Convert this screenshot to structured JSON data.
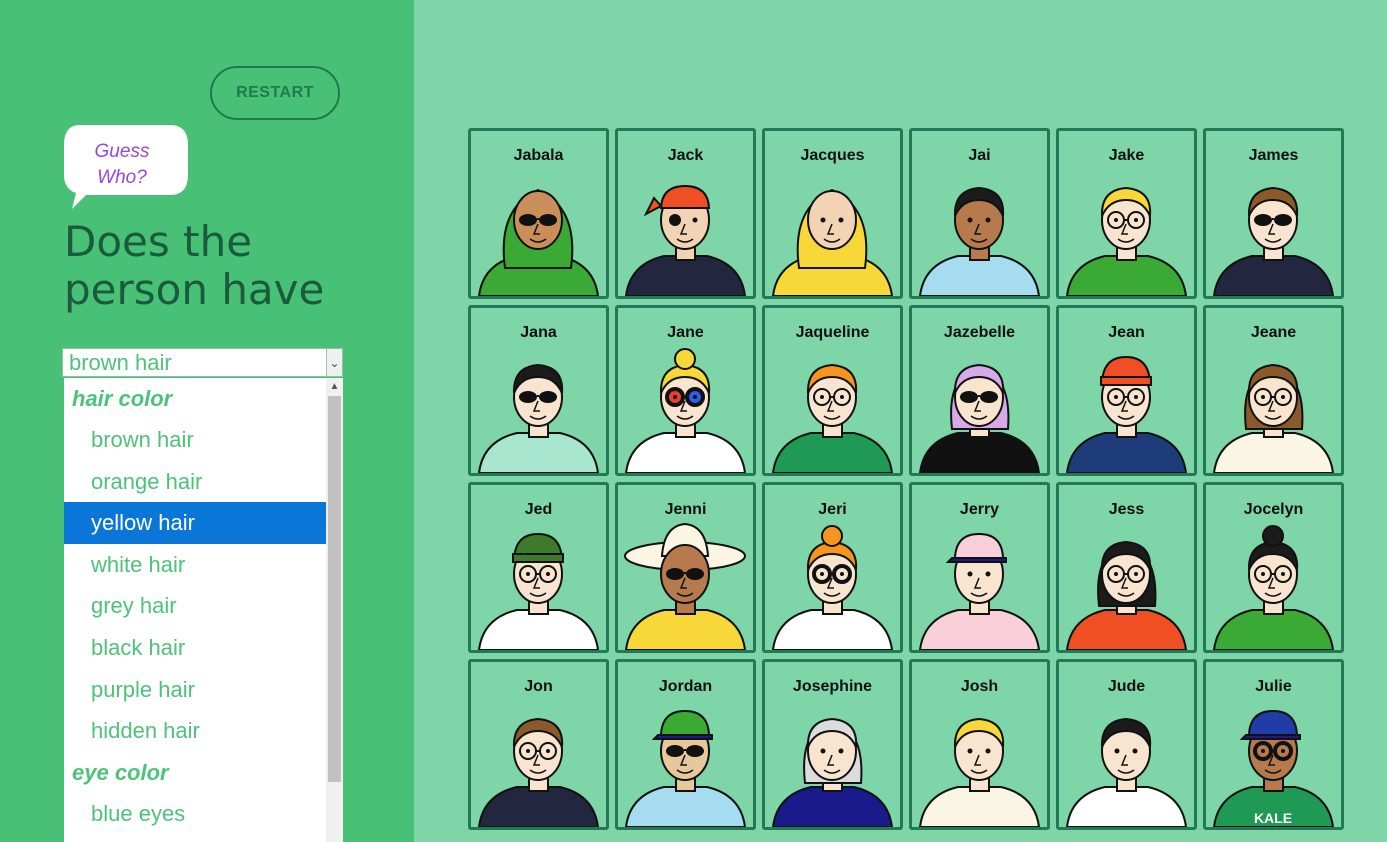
{
  "sidebar": {
    "restart_label": "RESTART",
    "logo_line1": "Guess",
    "logo_line2": "Who?",
    "question": "Does the person have",
    "select": {
      "value": "brown hair",
      "groups": [
        {
          "label": "hair color",
          "options": [
            "brown hair",
            "orange hair",
            "yellow hair",
            "white hair",
            "grey hair",
            "black hair",
            "purple hair",
            "hidden hair"
          ]
        },
        {
          "label": "eye color",
          "options": [
            "blue eyes"
          ]
        }
      ],
      "highlighted": "yellow hair"
    }
  },
  "cards": [
    {
      "name": "Jabala",
      "skin": "#c98e5a",
      "hair": "#3aaa35",
      "shirt": "#3aaa35",
      "hat": "hijab",
      "glasses": "sun"
    },
    {
      "name": "Jack",
      "skin": "#f2d3b3",
      "hair": "#f04e23",
      "shirt": "#22263f",
      "hat": "bandana",
      "glasses": "patch"
    },
    {
      "name": "Jacques",
      "skin": "#f2d3b3",
      "hair": "#f7d838",
      "shirt": "#f7d838",
      "hat": "hood",
      "glasses": "none"
    },
    {
      "name": "Jai",
      "skin": "#b77a4c",
      "hair": "#1b1b1b",
      "shirt": "#a6dcf0",
      "hat": "none",
      "glasses": "none"
    },
    {
      "name": "Jake",
      "skin": "#f8e4cf",
      "hair": "#f7d838",
      "shirt": "#3aaa35",
      "hat": "none",
      "glasses": "regular"
    },
    {
      "name": "James",
      "skin": "#f8e4cf",
      "hair": "#8a5a2b",
      "shirt": "#22263f",
      "hat": "none",
      "glasses": "sun"
    },
    {
      "name": "Jana",
      "skin": "#f8e4cf",
      "hair": "#1b1b1b",
      "shirt": "#a8e6cf",
      "hat": "none",
      "glasses": "sun"
    },
    {
      "name": "Jane",
      "skin": "#f8e4cf",
      "hair": "#f7d838",
      "shirt": "#ffffff",
      "hat": "bun",
      "glasses": "round"
    },
    {
      "name": "Jaqueline",
      "skin": "#f8e4cf",
      "hair": "#f7941d",
      "shirt": "#1f9a55",
      "hat": "none",
      "glasses": "regular"
    },
    {
      "name": "Jazebelle",
      "skin": "#f8e4cf",
      "hair": "#d7a9e8",
      "shirt": "#111111",
      "hat": "none",
      "glasses": "sun"
    },
    {
      "name": "Jean",
      "skin": "#f8e4cf",
      "hair": "#f04e23",
      "shirt": "#1f3c7a",
      "hat": "beanie",
      "glasses": "regular"
    },
    {
      "name": "Jeane",
      "skin": "#f8e4cf",
      "hair": "#8a5a2b",
      "shirt": "#fbf6e3",
      "hat": "none",
      "glasses": "regular"
    },
    {
      "name": "Jed",
      "skin": "#f8e4cf",
      "hair": "#f7941d",
      "shirt": "#ffffff",
      "hat": "beanie-green",
      "glasses": "regular"
    },
    {
      "name": "Jenni",
      "skin": "#b77a4c",
      "hair": "#fbf6e3",
      "shirt": "#f7d838",
      "hat": "sunhat",
      "glasses": "sun"
    },
    {
      "name": "Jeri",
      "skin": "#f8e4cf",
      "hair": "#f7941d",
      "shirt": "#ffffff",
      "hat": "bun",
      "glasses": "round-black"
    },
    {
      "name": "Jerry",
      "skin": "#f8e4cf",
      "hair": "#1b1b1b",
      "shirt": "#f9cfd9",
      "hat": "cap",
      "glasses": "none"
    },
    {
      "name": "Jess",
      "skin": "#f8e4cf",
      "hair": "#1b1b1b",
      "shirt": "#f04e23",
      "hat": "none",
      "glasses": "regular"
    },
    {
      "name": "Jocelyn",
      "skin": "#f8e4cf",
      "hair": "#1b1b1b",
      "shirt": "#3aaa35",
      "hat": "bun",
      "glasses": "regular"
    },
    {
      "name": "Jon",
      "skin": "#f8e4cf",
      "hair": "#8a5a2b",
      "shirt": "#22263f",
      "hat": "none",
      "glasses": "regular"
    },
    {
      "name": "Jordan",
      "skin": "#e6c89a",
      "hair": "#f7d838",
      "shirt": "#a6dcf0",
      "hat": "cap-green",
      "glasses": "sun"
    },
    {
      "name": "Josephine",
      "skin": "#f8e4cf",
      "hair": "#dcdcdc",
      "shirt": "#1a1a8a",
      "hat": "none",
      "glasses": "none"
    },
    {
      "name": "Josh",
      "skin": "#f8e4cf",
      "hair": "#f7d838",
      "shirt": "#fbf6e3",
      "hat": "none",
      "glasses": "none"
    },
    {
      "name": "Jude",
      "skin": "#f8e4cf",
      "hair": "#1b1b1b",
      "shirt": "#ffffff",
      "hat": "none",
      "glasses": "none"
    },
    {
      "name": "Julie",
      "skin": "#b77a4c",
      "hair": "#1b1b1b",
      "shirt": "#1f9a55",
      "hat": "cap-blue",
      "glasses": "round-black",
      "shirt_text": "KALE"
    }
  ]
}
